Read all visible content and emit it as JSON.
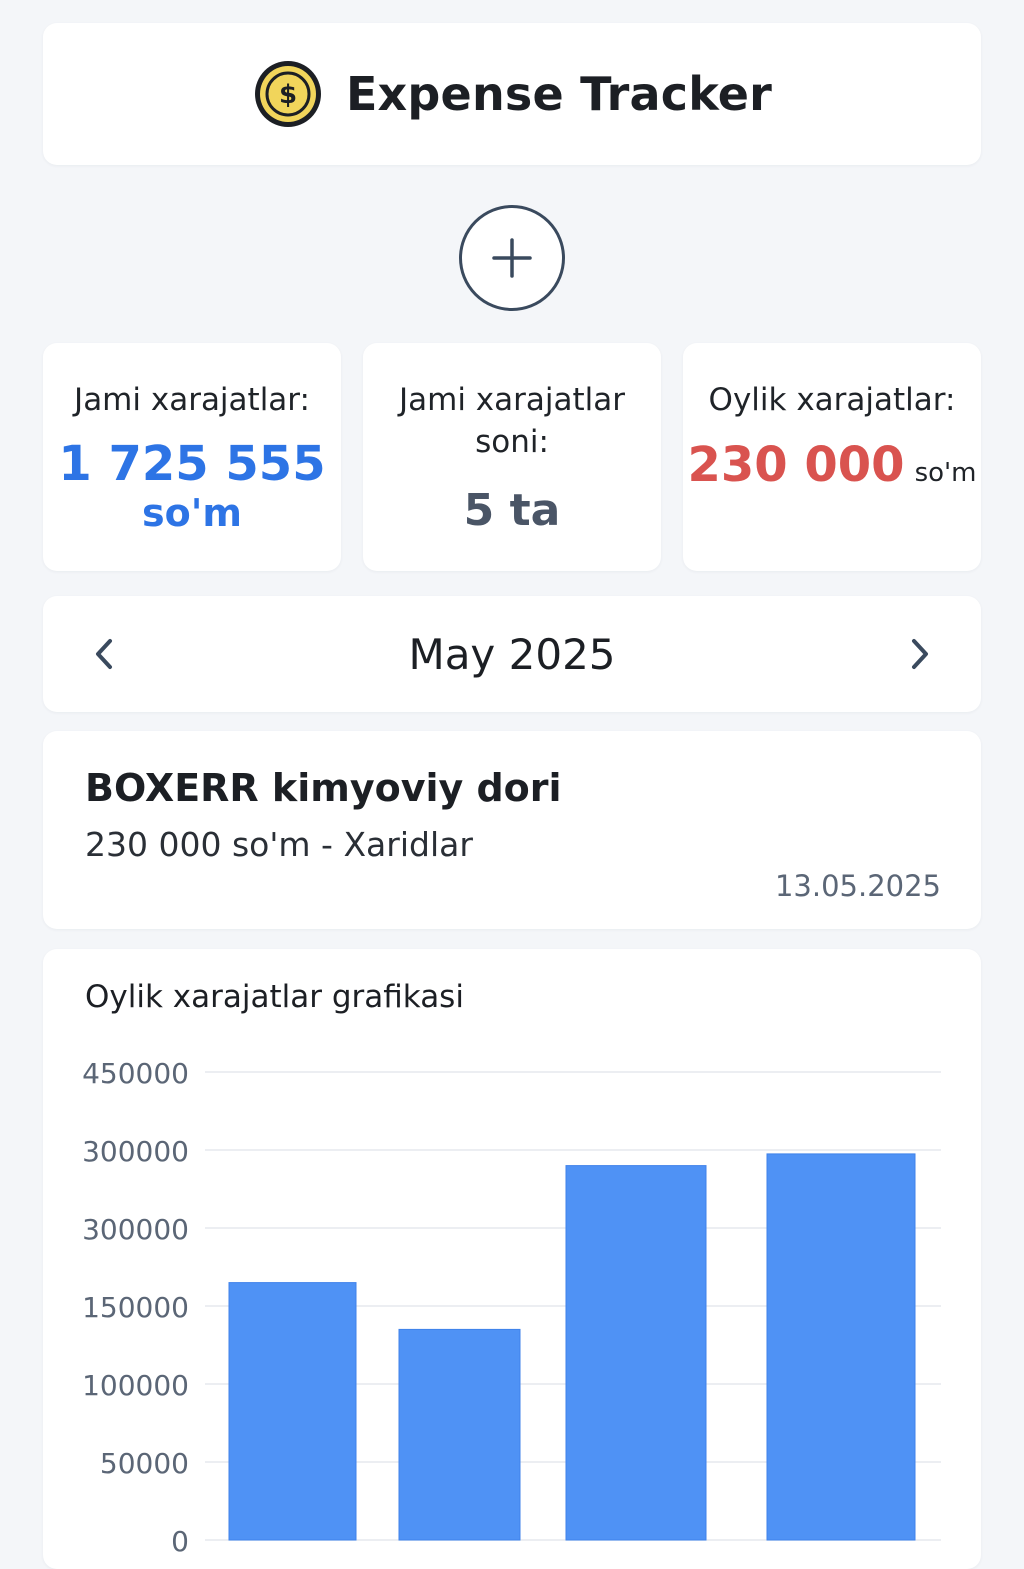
{
  "header": {
    "title": "Expense Tracker",
    "icon": "dollar-coin-icon"
  },
  "add_button": {
    "icon": "plus-icon"
  },
  "stats": {
    "total_label": "Jami xarajatlar:",
    "total_value": "1 725 555",
    "total_unit": "so'm",
    "count_label": "Jami xarajatlar soni:",
    "count_value": "5 ta",
    "monthly_label": "Oylik xarajatlar:",
    "monthly_value": "230 000",
    "monthly_unit": "so'm"
  },
  "month_selector": {
    "label": "May 2025",
    "prev_icon": "chevron-left-icon",
    "next_icon": "chevron-right-icon"
  },
  "expense": {
    "name": "BOXERR kimyoviy dori",
    "detail": "230 000 so'm - Xaridlar",
    "date": "13.05.2025"
  },
  "colors": {
    "accent_blue": "#2d74e5",
    "bar_blue": "#4f92f5",
    "expense_red": "#d9534f",
    "coin_gold": "#f1d55b"
  },
  "chart_data": {
    "type": "bar",
    "title": "Oylik xarajatlar grafikasi",
    "y_tick_labels": [
      "450000",
      "300000",
      "300000",
      "150000",
      "100000",
      "50000",
      "0"
    ],
    "y_ticks": [
      450000,
      350000,
      250000,
      150000,
      100000,
      50000,
      0
    ],
    "values": [
      180000,
      135000,
      330000,
      345000
    ],
    "grid": true
  }
}
